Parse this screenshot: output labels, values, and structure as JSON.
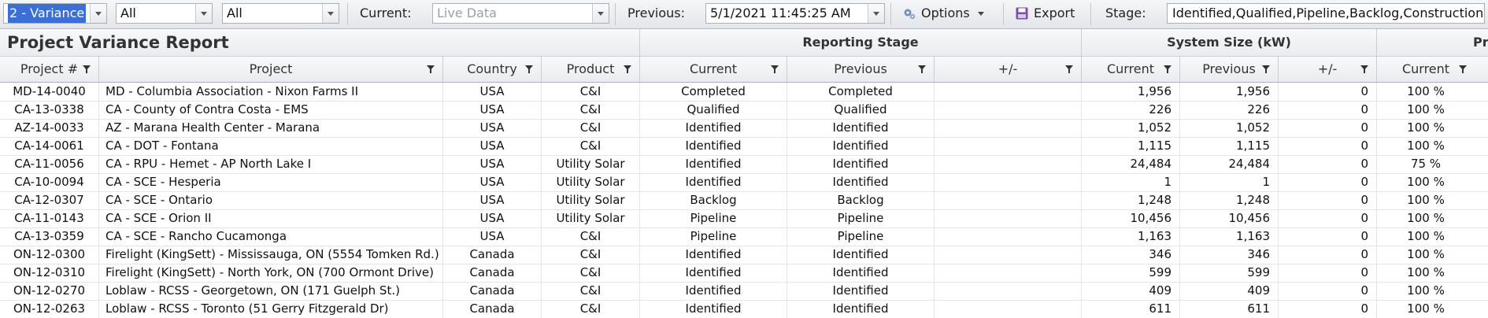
{
  "toolbar": {
    "view_select": "2 - Variance",
    "filter1": "All",
    "filter2": "All",
    "current_label": "Current:",
    "current_placeholder": "Live Data",
    "previous_label": "Previous:",
    "previous_value": "5/1/2021 11:45:25 AM",
    "options_label": "Options",
    "export_label": "Export",
    "stage_label": "Stage:",
    "stage_value": "Identified,Qualified,Pipeline,Backlog,Construction,Int"
  },
  "report": {
    "title": "Project Variance Report",
    "groups": {
      "reporting_stage": "Reporting Stage",
      "system_size": "System Size (kW)",
      "partial": "Pro"
    },
    "columns": {
      "project_num": "Project #",
      "project": "Project",
      "country": "Country",
      "product": "Product",
      "stage_current": "Current",
      "stage_previous": "Previous",
      "stage_delta": "+/-",
      "size_current": "Current",
      "size_previous": "Previous",
      "size_delta": "+/-",
      "pct_current": "Current"
    },
    "rows": [
      {
        "num": "MD-14-0040",
        "project": "MD - Columbia Association - Nixon Farms II",
        "country": "USA",
        "product": "C&I",
        "stage_cur": "Completed",
        "stage_prev": "Completed",
        "stage_delta": "",
        "size_cur": "1,956",
        "size_prev": "1,956",
        "size_delta": "0",
        "pct": "100 %"
      },
      {
        "num": "CA-13-0338",
        "project": "CA - County of Contra Costa - EMS",
        "country": "USA",
        "product": "C&I",
        "stage_cur": "Qualified",
        "stage_prev": "Qualified",
        "stage_delta": "",
        "size_cur": "226",
        "size_prev": "226",
        "size_delta": "0",
        "pct": "100 %"
      },
      {
        "num": "AZ-14-0033",
        "project": "AZ - Marana Health Center - Marana",
        "country": "USA",
        "product": "C&I",
        "stage_cur": "Identified",
        "stage_prev": "Identified",
        "stage_delta": "",
        "size_cur": "1,052",
        "size_prev": "1,052",
        "size_delta": "0",
        "pct": "100 %"
      },
      {
        "num": "CA-14-0061",
        "project": "CA - DOT - Fontana",
        "country": "USA",
        "product": "C&I",
        "stage_cur": "Identified",
        "stage_prev": "Identified",
        "stage_delta": "",
        "size_cur": "1,115",
        "size_prev": "1,115",
        "size_delta": "0",
        "pct": "100 %"
      },
      {
        "num": "CA-11-0056",
        "project": "CA - RPU - Hemet - AP North Lake I",
        "country": "USA",
        "product": "Utility Solar",
        "stage_cur": "Identified",
        "stage_prev": "Identified",
        "stage_delta": "",
        "size_cur": "24,484",
        "size_prev": "24,484",
        "size_delta": "0",
        "pct": "75 %"
      },
      {
        "num": "CA-10-0094",
        "project": "CA - SCE - Hesperia",
        "country": "USA",
        "product": "Utility Solar",
        "stage_cur": "Identified",
        "stage_prev": "Identified",
        "stage_delta": "",
        "size_cur": "1",
        "size_prev": "1",
        "size_delta": "0",
        "pct": "100 %"
      },
      {
        "num": "CA-12-0307",
        "project": "CA - SCE - Ontario",
        "country": "USA",
        "product": "Utility Solar",
        "stage_cur": "Backlog",
        "stage_prev": "Backlog",
        "stage_delta": "",
        "size_cur": "1,248",
        "size_prev": "1,248",
        "size_delta": "0",
        "pct": "100 %"
      },
      {
        "num": "CA-11-0143",
        "project": "CA - SCE - Orion II",
        "country": "USA",
        "product": "Utility Solar",
        "stage_cur": "Pipeline",
        "stage_prev": "Pipeline",
        "stage_delta": "",
        "size_cur": "10,456",
        "size_prev": "10,456",
        "size_delta": "0",
        "pct": "100 %"
      },
      {
        "num": "CA-13-0359",
        "project": "CA - SCE - Rancho Cucamonga",
        "country": "USA",
        "product": "C&I",
        "stage_cur": "Pipeline",
        "stage_prev": "Pipeline",
        "stage_delta": "",
        "size_cur": "1,163",
        "size_prev": "1,163",
        "size_delta": "0",
        "pct": "100 %"
      },
      {
        "num": "ON-12-0300",
        "project": "Firelight (KingSett) - Mississauga, ON (5554 Tomken Rd.)",
        "country": "Canada",
        "product": "C&I",
        "stage_cur": "Identified",
        "stage_prev": "Identified",
        "stage_delta": "",
        "size_cur": "346",
        "size_prev": "346",
        "size_delta": "0",
        "pct": "100 %"
      },
      {
        "num": "ON-12-0310",
        "project": "Firelight (KingSett) - North York, ON (700 Ormont Drive)",
        "country": "Canada",
        "product": "C&I",
        "stage_cur": "Identified",
        "stage_prev": "Identified",
        "stage_delta": "",
        "size_cur": "599",
        "size_prev": "599",
        "size_delta": "0",
        "pct": "100 %"
      },
      {
        "num": "ON-12-0270",
        "project": "Loblaw - RCSS - Georgetown, ON (171 Guelph St.)",
        "country": "Canada",
        "product": "C&I",
        "stage_cur": "Identified",
        "stage_prev": "Identified",
        "stage_delta": "",
        "size_cur": "409",
        "size_prev": "409",
        "size_delta": "0",
        "pct": "100 %"
      },
      {
        "num": "ON-12-0263",
        "project": "Loblaw - RCSS - Toronto (51 Gerry Fitzgerald Dr)",
        "country": "Canada",
        "product": "C&I",
        "stage_cur": "Identified",
        "stage_prev": "Identified",
        "stage_delta": "",
        "size_cur": "611",
        "size_prev": "611",
        "size_delta": "0",
        "pct": "100 %"
      }
    ]
  }
}
